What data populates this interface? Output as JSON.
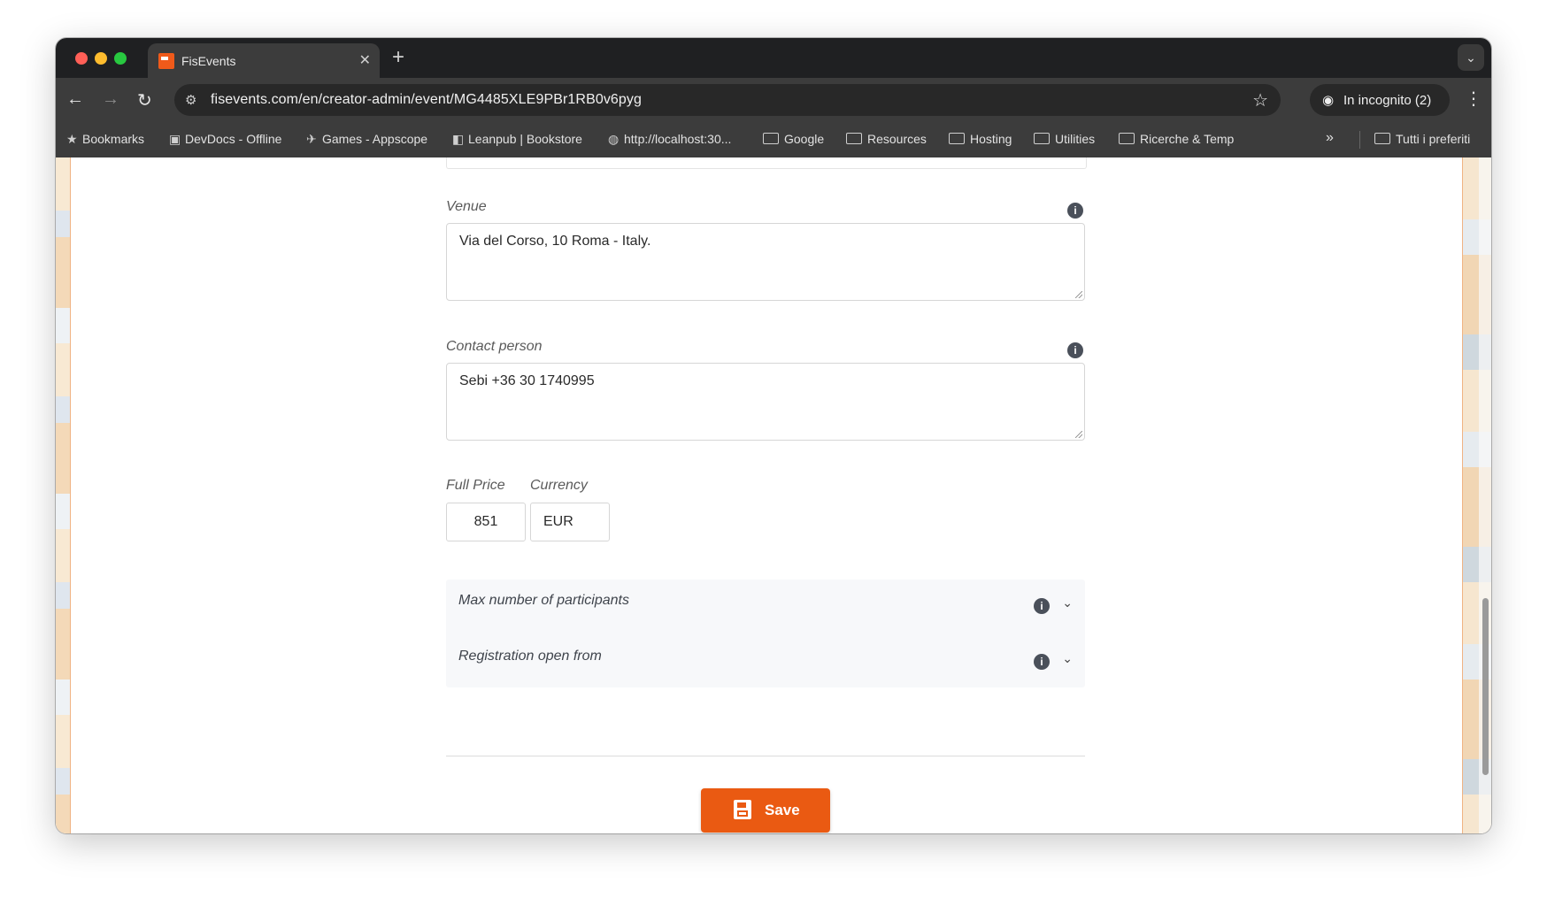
{
  "browser": {
    "tab": {
      "title": "FisEvents"
    },
    "url": "fisevents.com/en/creator-admin/event/MG4485XLE9PBr1RB0v6pyg",
    "incognito_label": "In incognito (2)",
    "bookmarks": [
      {
        "label": "Bookmarks",
        "icon": "star-icon"
      },
      {
        "label": "DevDocs - Offline",
        "icon": "devdocs-icon"
      },
      {
        "label": "Games - Appscope",
        "icon": "appscope-icon"
      },
      {
        "label": "Leanpub | Bookstore",
        "icon": "leanpub-icon"
      },
      {
        "label": "http://localhost:30...",
        "icon": "globe-icon"
      },
      {
        "label": "Google",
        "icon": "folder-icon"
      },
      {
        "label": "Resources",
        "icon": "folder-icon"
      },
      {
        "label": "Hosting",
        "icon": "folder-icon"
      },
      {
        "label": "Utilities",
        "icon": "folder-icon"
      },
      {
        "label": "Ricerche & Temp",
        "icon": "folder-icon"
      },
      {
        "label": "Tutti i preferiti",
        "icon": "folder-icon"
      }
    ]
  },
  "form": {
    "venue": {
      "label": "Venue",
      "value": "Via del Corso, 10 Roma - Italy."
    },
    "contact": {
      "label": "Contact person",
      "value": "Sebi +36 30 1740995"
    },
    "price": {
      "label": "Full Price",
      "value": "851"
    },
    "currency": {
      "label": "Currency",
      "value": "EUR"
    },
    "accordion": [
      {
        "label": "Max number of participants"
      },
      {
        "label": "Registration open from"
      }
    ],
    "save_label": "Save"
  },
  "colors": {
    "accent": "#ea5a12",
    "browser_chrome": "#3c3c3c"
  }
}
